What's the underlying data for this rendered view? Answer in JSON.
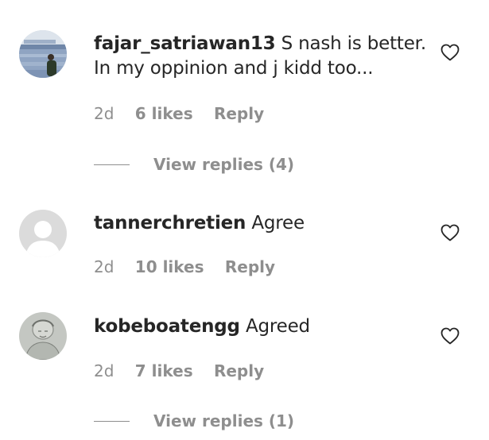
{
  "comments": [
    {
      "username": "fajar_satriawan13",
      "text_line1": "S nash is better.",
      "text_line2": "In my oppinion and j kidd too...",
      "time": "2d",
      "likes": "6 likes",
      "reply": "Reply",
      "view_replies": "View replies (4)",
      "avatar": "landscape-photo-avatar"
    },
    {
      "username": "tannerchretien",
      "text": "Agree",
      "time": "2d",
      "likes": "10 likes",
      "reply": "Reply",
      "avatar": "default-user-avatar"
    },
    {
      "username": "kobeboatengg",
      "text": "Agreed",
      "time": "2d",
      "likes": "7 likes",
      "reply": "Reply",
      "view_replies": "View replies (1)",
      "avatar": "sketch-portrait-avatar"
    }
  ],
  "colors": {
    "text": "#262626",
    "secondary": "#8e8e8e",
    "background": "#ffffff"
  },
  "icons": {
    "like": "heart-outline-icon"
  }
}
